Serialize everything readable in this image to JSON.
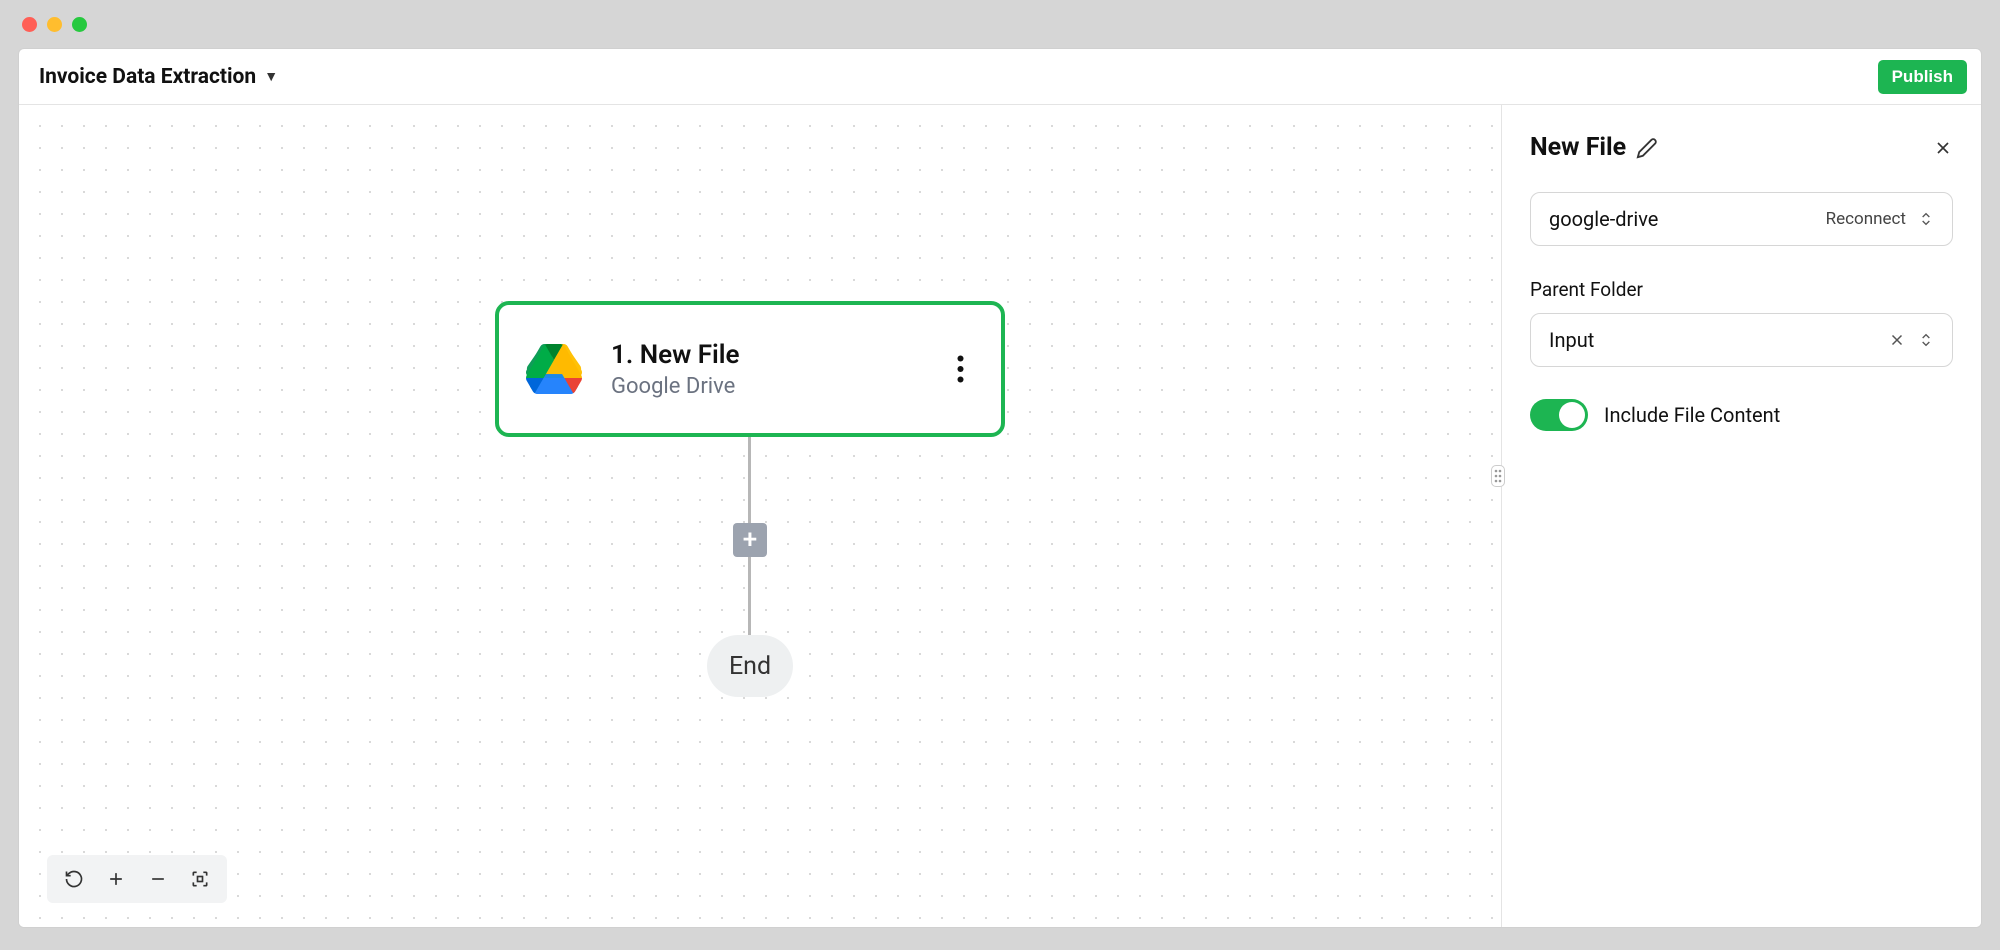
{
  "header": {
    "workflow_title": "Invoice Data Extraction",
    "publish_label": "Publish"
  },
  "canvas": {
    "node": {
      "title": "1. New File",
      "subtitle": "Google Drive",
      "icon": "google-drive-icon"
    },
    "add_label": "+",
    "end_label": "End",
    "toolbar": {
      "refresh": "refresh-icon",
      "zoom_in": "plus-icon",
      "zoom_out": "minus-icon",
      "fit": "fit-screen-icon"
    }
  },
  "panel": {
    "title": "New File",
    "connection": {
      "value": "google-drive",
      "reconnect_label": "Reconnect"
    },
    "parent_folder": {
      "label": "Parent Folder",
      "value": "Input"
    },
    "include_content": {
      "label": "Include File Content",
      "enabled": true
    }
  }
}
